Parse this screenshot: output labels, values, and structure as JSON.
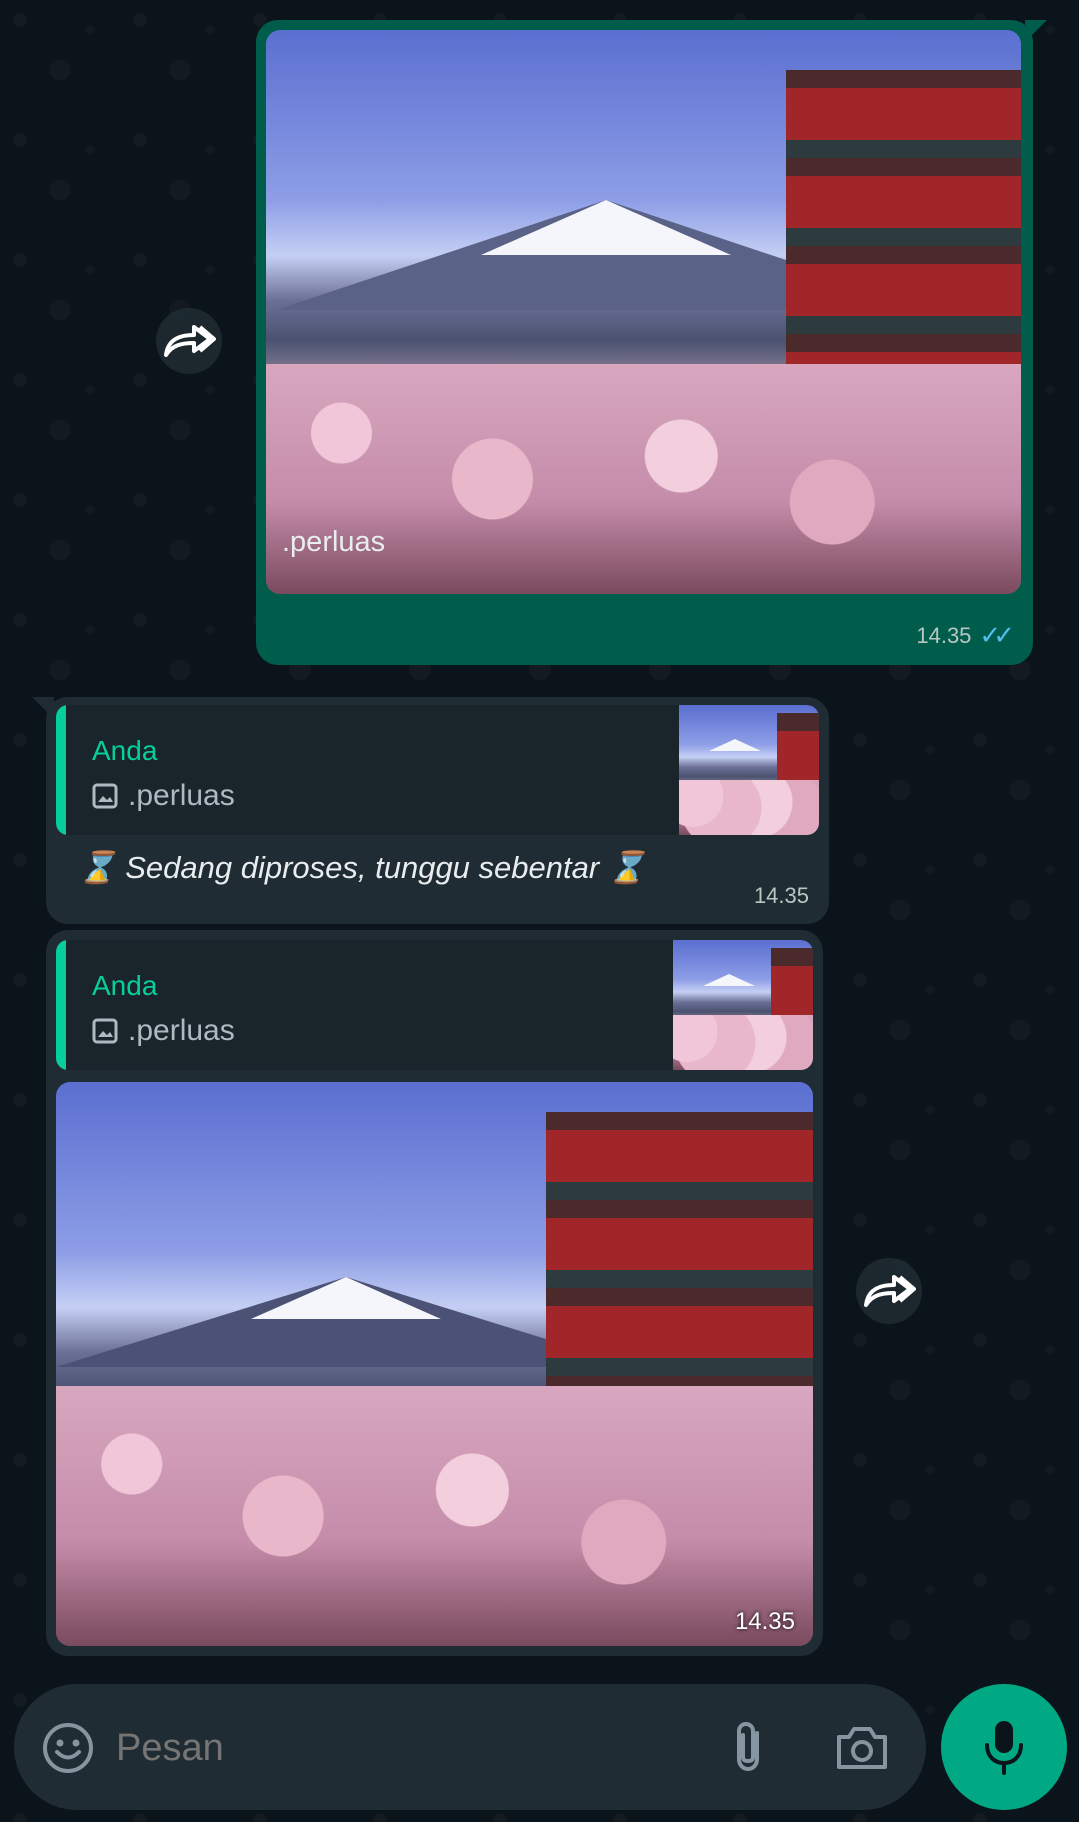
{
  "chat": {
    "messages": [
      {
        "direction": "outgoing",
        "type": "image",
        "caption": ".perluas",
        "time": "14.35",
        "status": "read"
      },
      {
        "direction": "incoming",
        "type": "text",
        "quote": {
          "author": "Anda",
          "text": ".perluas",
          "icon": "image-icon"
        },
        "text": "⌛ Sedang diproses, tunggu sebentar ⌛",
        "time": "14.35"
      },
      {
        "direction": "incoming",
        "type": "image",
        "quote": {
          "author": "Anda",
          "text": ".perluas",
          "icon": "image-icon"
        },
        "time": "14.35"
      }
    ]
  },
  "composer": {
    "placeholder": "Pesan",
    "icons": [
      "emoji-icon",
      "attach-icon",
      "camera-icon",
      "mic-icon"
    ]
  },
  "colors": {
    "background": "#0b141a",
    "outgoing_bubble": "#005c4b",
    "incoming_bubble": "#202c33",
    "accent": "#00a884",
    "quote_author": "#06cf9c",
    "read_ticks": "#53bdeb"
  }
}
